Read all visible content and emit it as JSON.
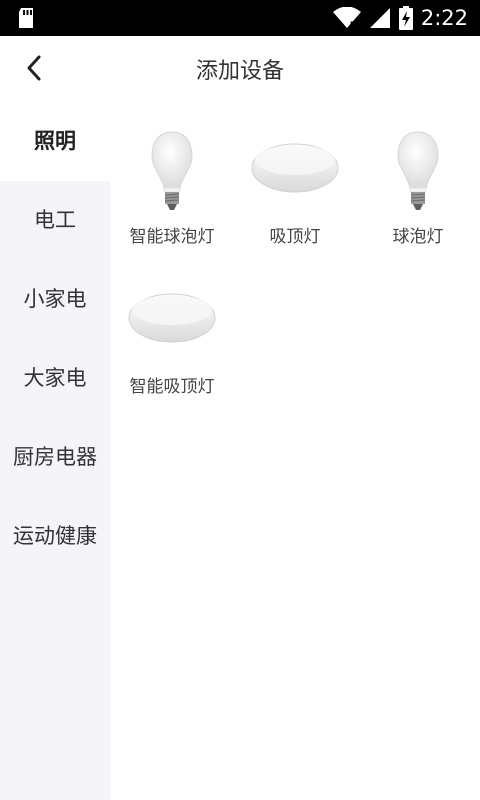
{
  "status_bar": {
    "time": "2:22"
  },
  "header": {
    "title": "添加设备"
  },
  "categories": [
    "照明",
    "电工",
    "小家电",
    "大家电",
    "厨房电器",
    "运动健康"
  ],
  "devices": [
    {
      "label": "智能球泡灯",
      "icon": "bulb-icon"
    },
    {
      "label": "吸顶灯",
      "icon": "ceiling-light-icon"
    },
    {
      "label": "球泡灯",
      "icon": "bulb-icon"
    },
    {
      "label": "智能吸顶灯",
      "icon": "ceiling-light-icon"
    }
  ]
}
